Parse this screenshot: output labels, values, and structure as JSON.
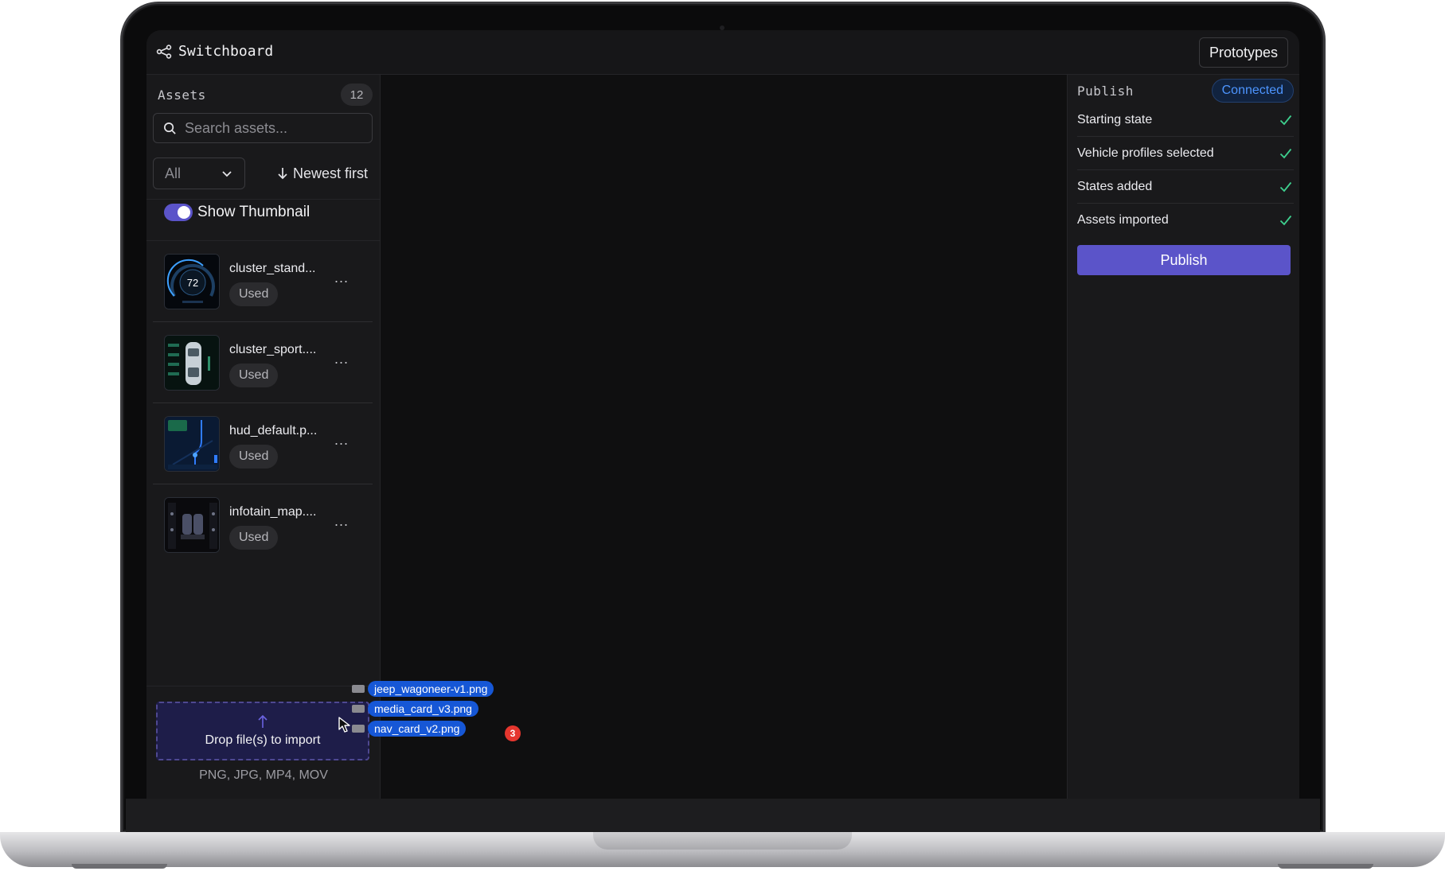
{
  "app": {
    "title": "Switchboard",
    "prototypes_label": "Prototypes"
  },
  "sidebar": {
    "title": "Assets",
    "count": "12",
    "search_placeholder": "Search assets...",
    "filter_value": "All",
    "sort_label": "Newest first",
    "thumbnail_toggle_label": "Show Thumbnail",
    "thumbnail_toggle_on": true,
    "items": [
      {
        "name": "cluster_stand...",
        "badge": "Used",
        "thumb": "gauge-cluster"
      },
      {
        "name": "cluster_sport....",
        "badge": "Used",
        "thumb": "car-topview"
      },
      {
        "name": "hud_default.p...",
        "badge": "Used",
        "thumb": "navigation-map"
      },
      {
        "name": "infotain_map....",
        "badge": "Used",
        "thumb": "seat-controls"
      }
    ],
    "more_label": "...",
    "drop_zone_label": "Drop file(s) to import",
    "formats_label": "PNG, JPG, MP4, MOV"
  },
  "thumbnails": {
    "gauge_value": "72"
  },
  "publish": {
    "title": "Publish",
    "status": "Connected",
    "checks": [
      {
        "label": "Starting state",
        "done": true
      },
      {
        "label": "Vehicle profiles selected",
        "done": true
      },
      {
        "label": "States added",
        "done": true
      },
      {
        "label": "Assets imported",
        "done": true
      }
    ],
    "button_label": "Publish"
  },
  "drag": {
    "files": [
      "jeep_wagoneer-v1.png",
      "media_card_v3.png",
      "nav_card_v2.png"
    ],
    "count": "3"
  },
  "colors": {
    "accent": "#5b54c9",
    "connected": "#4d95ff",
    "check": "#3ecf8e",
    "drag_chip": "#1657d6",
    "badge_red": "#e5362e"
  }
}
